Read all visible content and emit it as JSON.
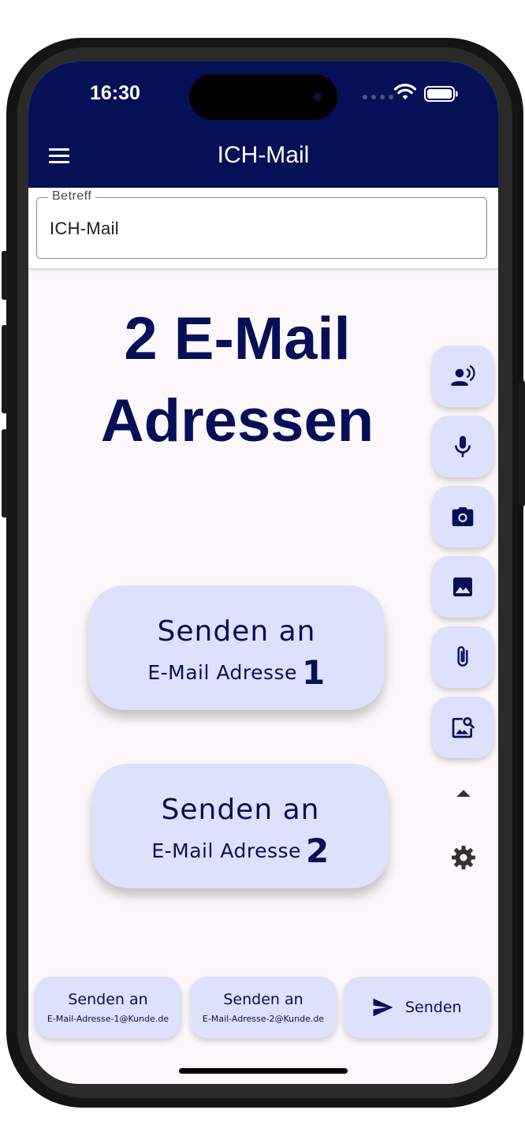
{
  "status_bar": {
    "time": "16:30"
  },
  "app_bar": {
    "title": "ICH-Mail",
    "menu_icon": "menu-icon"
  },
  "subject": {
    "label": "Betreff",
    "value": "ICH-Mail"
  },
  "heading": {
    "line1": "2 E-Mail",
    "line2": "Adressen"
  },
  "send_buttons": [
    {
      "line1": "Senden an",
      "line2": "E-Mail Adresse",
      "number": "1"
    },
    {
      "line1": "Senden an",
      "line2": "E-Mail Adresse",
      "number": "2"
    }
  ],
  "side_actions": [
    {
      "icon": "voice-recognition-icon"
    },
    {
      "icon": "microphone-icon"
    },
    {
      "icon": "camera-icon"
    },
    {
      "icon": "image-icon"
    },
    {
      "icon": "attachment-icon"
    },
    {
      "icon": "image-search-icon"
    },
    {
      "icon": "arrow-up-icon"
    },
    {
      "icon": "settings-gear-icon"
    }
  ],
  "bottom_bar": {
    "recipient1": {
      "line1": "Senden an",
      "line2": "E-Mail-Adresse-1@Kunde.de"
    },
    "recipient2": {
      "line1": "Senden an",
      "line2": "E-Mail-Adresse-2@Kunde.de"
    },
    "send": {
      "label": "Senden",
      "icon": "send-icon"
    }
  },
  "colors": {
    "primary": "#051057",
    "button_bg": "#dde1fb",
    "screen_bg": "#fdf8fb"
  }
}
